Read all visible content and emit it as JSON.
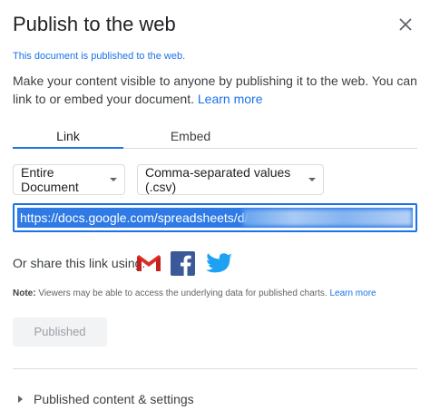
{
  "dialog": {
    "title": "Publish to the web",
    "close_icon": "close-icon",
    "status": "This document is published to the web.",
    "description": "Make your content visible to anyone by publishing it to the web. You can link to or embed your document.",
    "learn_more": "Learn more"
  },
  "tabs": [
    {
      "label": "Link",
      "active": true
    },
    {
      "label": "Embed",
      "active": false
    }
  ],
  "options": {
    "scope_selected": "Entire Document",
    "format_selected": "Comma-separated values (.csv)"
  },
  "url": {
    "value": "https://docs.google.com/spreadsheets/d/"
  },
  "share": {
    "label": "Or share this link using:",
    "services": [
      "gmail-icon",
      "facebook-icon",
      "twitter-icon"
    ]
  },
  "note": {
    "prefix": "Note:",
    "text": " Viewers may be able to access the underlying data for published charts. ",
    "link": "Learn more"
  },
  "publish_button": {
    "label": "Published"
  },
  "expander": {
    "label": "Published content & settings"
  },
  "colors": {
    "accent": "#1a73e8",
    "text": "#202124",
    "muted": "#5f6368"
  }
}
